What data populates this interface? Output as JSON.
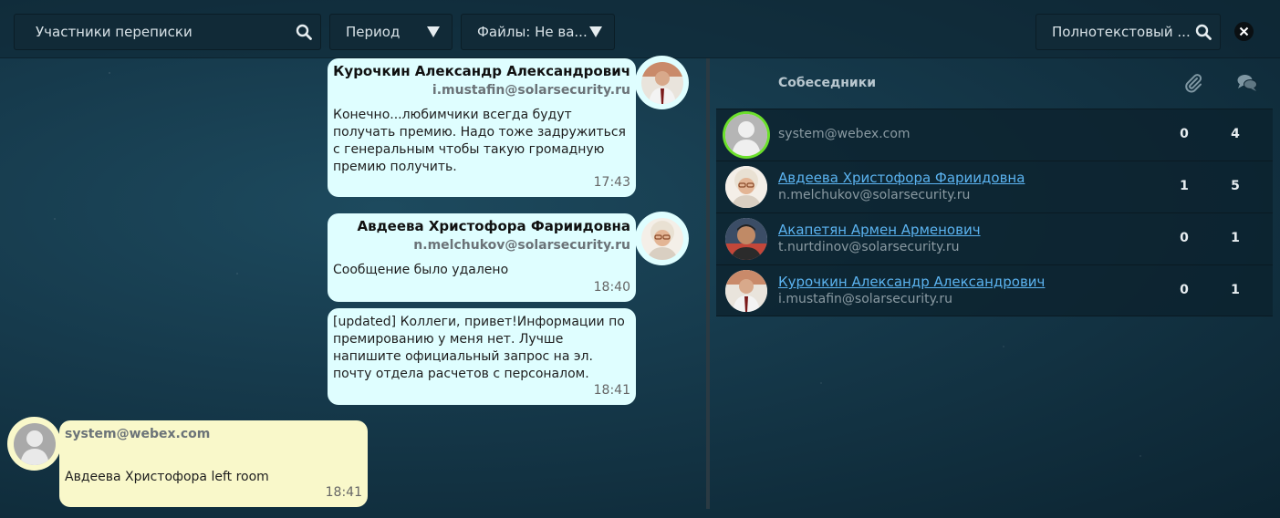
{
  "toolbar": {
    "participants_placeholder": "Участники переписки",
    "period_label": "Период",
    "files_label": "Файлы: Не ва...",
    "fulltext_label": "Полнотекстовый ..."
  },
  "messages": [
    {
      "name": "Курочкин Александр Александрович",
      "email": "i.mustafin@solarsecurity.ru",
      "text": "Конечно...любимчики всегда будут получать премию. Надо тоже задружиться с генеральным чтобы такую громадную премию получить.",
      "time": "17:43"
    },
    {
      "name": "Авдеева Христофора Фариидовна",
      "email": "n.melchukov@solarsecurity.ru",
      "text": "Сообщение было удалено",
      "time": "18:40"
    },
    {
      "text": "[updated] Коллеги, привет!Информации по премированию у меня нет. Лучше напишите официальный запрос на эл. почту отдела расчетов с персоналом.",
      "time": "18:41"
    },
    {
      "email": "system@webex.com",
      "text": "Авдеева Христофора left room",
      "time": "18:41"
    }
  ],
  "panel": {
    "title": "Собеседники",
    "rows": [
      {
        "email": "system@webex.com",
        "files": "0",
        "messages": "4"
      },
      {
        "name": "Авдеева Христофора Фариидовна",
        "email": "n.melchukov@solarsecurity.ru",
        "files": "1",
        "messages": "5"
      },
      {
        "name": "Акапетян Армен Арменович",
        "email": "t.nurtdinov@solarsecurity.ru",
        "files": "0",
        "messages": "1"
      },
      {
        "name": "Курочкин Александр Александрович",
        "email": "i.mustafin@solarsecurity.ru",
        "files": "0",
        "messages": "1"
      }
    ]
  },
  "colors": {
    "bubble_own": "#dffeff",
    "bubble_system": "#f9f8ca",
    "link": "#5bb3f0",
    "online": "#6ce02c"
  }
}
